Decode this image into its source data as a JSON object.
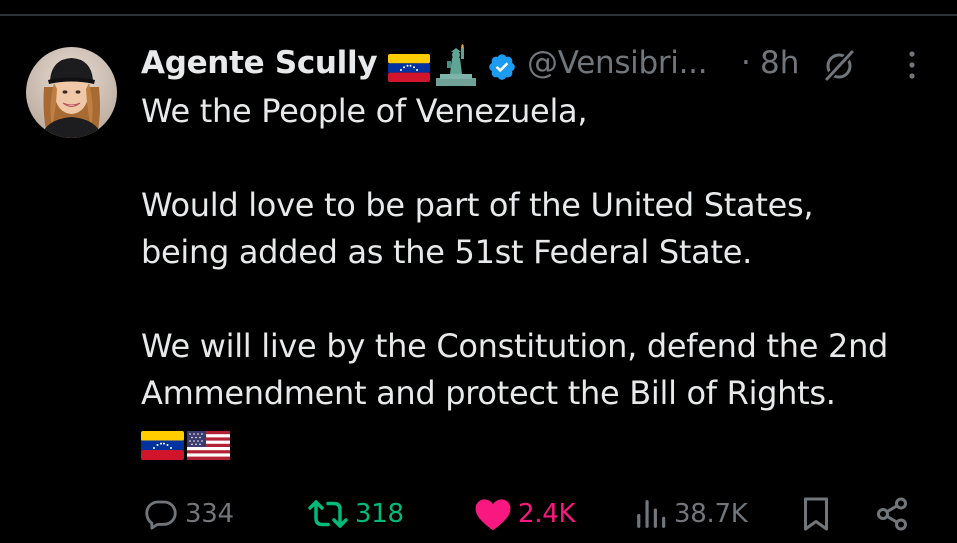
{
  "post": {
    "author": {
      "display_name": "Agente Scully",
      "handle": "@Vensibri...",
      "verified": true,
      "name_emoji": [
        "venezuela-flag",
        "statue-of-liberty"
      ]
    },
    "separator": "·",
    "timestamp": "8h",
    "text_lines": {
      "line1": "We the People of Venezuela,",
      "line2": "Would love to be part of the United States,",
      "line3": "being added as the 51st Federal State.",
      "line4": "We will live by the Constitution, defend the 2nd",
      "line5": "Ammendment and protect the Bill of Rights."
    },
    "trailing_emoji": [
      "venezuela-flag",
      "us-flag"
    ]
  },
  "actions": {
    "replies": "334",
    "reposts": "318",
    "likes": "2.4K",
    "views": "38.7K"
  },
  "colors": {
    "background": "#000000",
    "text_primary": "#e7e9ea",
    "text_secondary": "#71767b",
    "verified": "#1d9bf0",
    "repost_active": "#00ba7c",
    "like_active": "#f91880",
    "divider": "#2f3336"
  }
}
